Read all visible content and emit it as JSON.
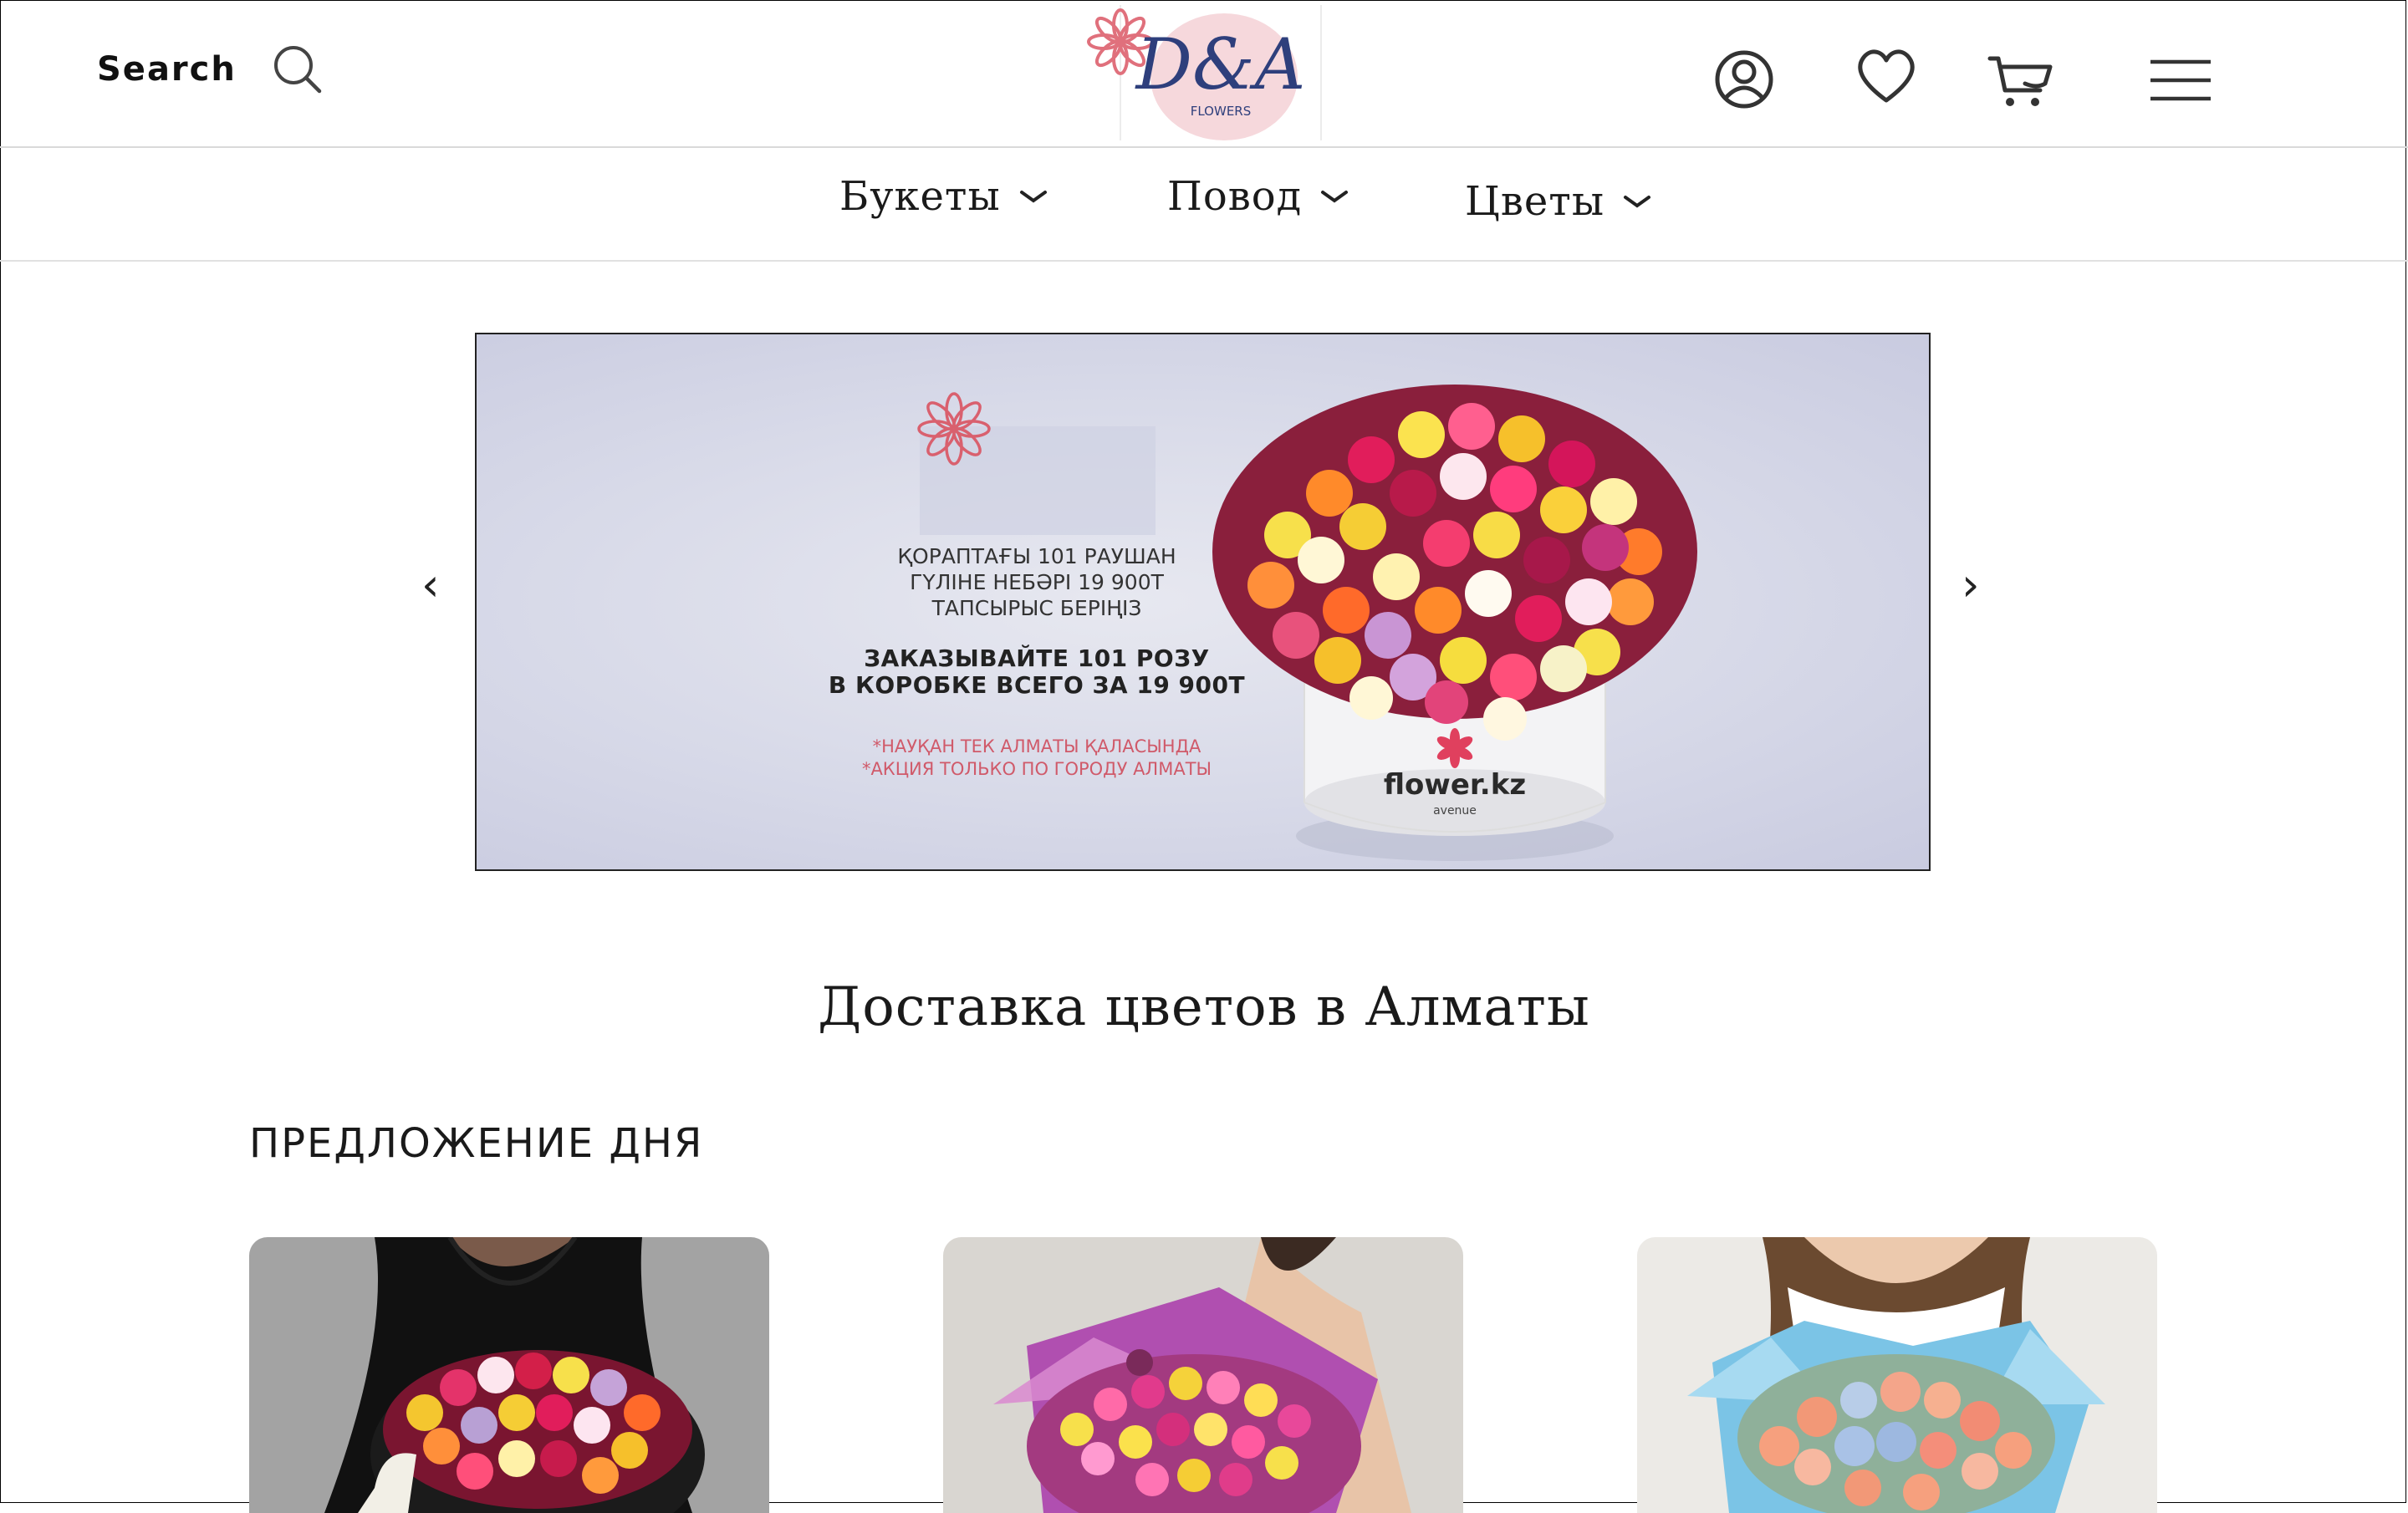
{
  "header": {
    "search_label": "Search",
    "logo": {
      "monogram": "D&A",
      "caption": "FLOWERS"
    },
    "icons": [
      "user-icon",
      "heart-icon",
      "cart-icon",
      "menu-icon"
    ]
  },
  "nav": {
    "items": [
      {
        "label": "Букеты"
      },
      {
        "label": "Повод"
      },
      {
        "label": "Цветы"
      }
    ]
  },
  "banner": {
    "kz_text": [
      "ҚОРАПТАҒЫ 101 РАУШАН",
      "ГҮЛІНЕ НЕБӘРІ 19 900Т",
      "ТАПСЫРЫС БЕРІҢІЗ"
    ],
    "ru_text": [
      "ЗАКАЗЫВАЙТЕ 101 РОЗУ",
      "В КОРОБКЕ ВСЕГО ЗА 19 900Т"
    ],
    "notes": [
      "*НАУҚАН ТЕК АЛМАТЫ ҚАЛАСЫНДА",
      "*АКЦИЯ ТОЛЬКО ПО ГОРОДУ АЛМАТЫ"
    ],
    "box_brand": "flower.kz",
    "box_sub": "avenue",
    "prev_arrow": "‹",
    "next_arrow": "›"
  },
  "main": {
    "title": "Доставка цветов в Алматы",
    "section_title": "ПРЕДЛОЖЕНИЕ ДНЯ"
  },
  "colors": {
    "accent_pink": "#e0707c",
    "logo_blue": "#2e3f7c",
    "banner_bg": "#d7d9e8"
  }
}
